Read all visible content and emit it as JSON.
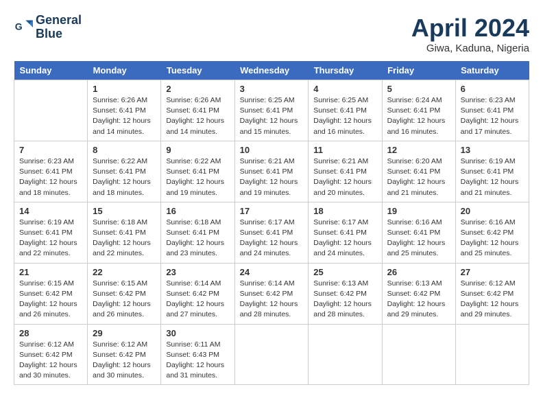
{
  "header": {
    "logo_line1": "General",
    "logo_line2": "Blue",
    "month": "April 2024",
    "location": "Giwa, Kaduna, Nigeria"
  },
  "days_of_week": [
    "Sunday",
    "Monday",
    "Tuesday",
    "Wednesday",
    "Thursday",
    "Friday",
    "Saturday"
  ],
  "weeks": [
    [
      {
        "day": "",
        "info": ""
      },
      {
        "day": "1",
        "info": "Sunrise: 6:26 AM\nSunset: 6:41 PM\nDaylight: 12 hours\nand 14 minutes."
      },
      {
        "day": "2",
        "info": "Sunrise: 6:26 AM\nSunset: 6:41 PM\nDaylight: 12 hours\nand 14 minutes."
      },
      {
        "day": "3",
        "info": "Sunrise: 6:25 AM\nSunset: 6:41 PM\nDaylight: 12 hours\nand 15 minutes."
      },
      {
        "day": "4",
        "info": "Sunrise: 6:25 AM\nSunset: 6:41 PM\nDaylight: 12 hours\nand 16 minutes."
      },
      {
        "day": "5",
        "info": "Sunrise: 6:24 AM\nSunset: 6:41 PM\nDaylight: 12 hours\nand 16 minutes."
      },
      {
        "day": "6",
        "info": "Sunrise: 6:23 AM\nSunset: 6:41 PM\nDaylight: 12 hours\nand 17 minutes."
      }
    ],
    [
      {
        "day": "7",
        "info": "Sunrise: 6:23 AM\nSunset: 6:41 PM\nDaylight: 12 hours\nand 18 minutes."
      },
      {
        "day": "8",
        "info": "Sunrise: 6:22 AM\nSunset: 6:41 PM\nDaylight: 12 hours\nand 18 minutes."
      },
      {
        "day": "9",
        "info": "Sunrise: 6:22 AM\nSunset: 6:41 PM\nDaylight: 12 hours\nand 19 minutes."
      },
      {
        "day": "10",
        "info": "Sunrise: 6:21 AM\nSunset: 6:41 PM\nDaylight: 12 hours\nand 19 minutes."
      },
      {
        "day": "11",
        "info": "Sunrise: 6:21 AM\nSunset: 6:41 PM\nDaylight: 12 hours\nand 20 minutes."
      },
      {
        "day": "12",
        "info": "Sunrise: 6:20 AM\nSunset: 6:41 PM\nDaylight: 12 hours\nand 21 minutes."
      },
      {
        "day": "13",
        "info": "Sunrise: 6:19 AM\nSunset: 6:41 PM\nDaylight: 12 hours\nand 21 minutes."
      }
    ],
    [
      {
        "day": "14",
        "info": "Sunrise: 6:19 AM\nSunset: 6:41 PM\nDaylight: 12 hours\nand 22 minutes."
      },
      {
        "day": "15",
        "info": "Sunrise: 6:18 AM\nSunset: 6:41 PM\nDaylight: 12 hours\nand 22 minutes."
      },
      {
        "day": "16",
        "info": "Sunrise: 6:18 AM\nSunset: 6:41 PM\nDaylight: 12 hours\nand 23 minutes."
      },
      {
        "day": "17",
        "info": "Sunrise: 6:17 AM\nSunset: 6:41 PM\nDaylight: 12 hours\nand 24 minutes."
      },
      {
        "day": "18",
        "info": "Sunrise: 6:17 AM\nSunset: 6:41 PM\nDaylight: 12 hours\nand 24 minutes."
      },
      {
        "day": "19",
        "info": "Sunrise: 6:16 AM\nSunset: 6:41 PM\nDaylight: 12 hours\nand 25 minutes."
      },
      {
        "day": "20",
        "info": "Sunrise: 6:16 AM\nSunset: 6:42 PM\nDaylight: 12 hours\nand 25 minutes."
      }
    ],
    [
      {
        "day": "21",
        "info": "Sunrise: 6:15 AM\nSunset: 6:42 PM\nDaylight: 12 hours\nand 26 minutes."
      },
      {
        "day": "22",
        "info": "Sunrise: 6:15 AM\nSunset: 6:42 PM\nDaylight: 12 hours\nand 26 minutes."
      },
      {
        "day": "23",
        "info": "Sunrise: 6:14 AM\nSunset: 6:42 PM\nDaylight: 12 hours\nand 27 minutes."
      },
      {
        "day": "24",
        "info": "Sunrise: 6:14 AM\nSunset: 6:42 PM\nDaylight: 12 hours\nand 28 minutes."
      },
      {
        "day": "25",
        "info": "Sunrise: 6:13 AM\nSunset: 6:42 PM\nDaylight: 12 hours\nand 28 minutes."
      },
      {
        "day": "26",
        "info": "Sunrise: 6:13 AM\nSunset: 6:42 PM\nDaylight: 12 hours\nand 29 minutes."
      },
      {
        "day": "27",
        "info": "Sunrise: 6:12 AM\nSunset: 6:42 PM\nDaylight: 12 hours\nand 29 minutes."
      }
    ],
    [
      {
        "day": "28",
        "info": "Sunrise: 6:12 AM\nSunset: 6:42 PM\nDaylight: 12 hours\nand 30 minutes."
      },
      {
        "day": "29",
        "info": "Sunrise: 6:12 AM\nSunset: 6:42 PM\nDaylight: 12 hours\nand 30 minutes."
      },
      {
        "day": "30",
        "info": "Sunrise: 6:11 AM\nSunset: 6:43 PM\nDaylight: 12 hours\nand 31 minutes."
      },
      {
        "day": "",
        "info": ""
      },
      {
        "day": "",
        "info": ""
      },
      {
        "day": "",
        "info": ""
      },
      {
        "day": "",
        "info": ""
      }
    ]
  ]
}
